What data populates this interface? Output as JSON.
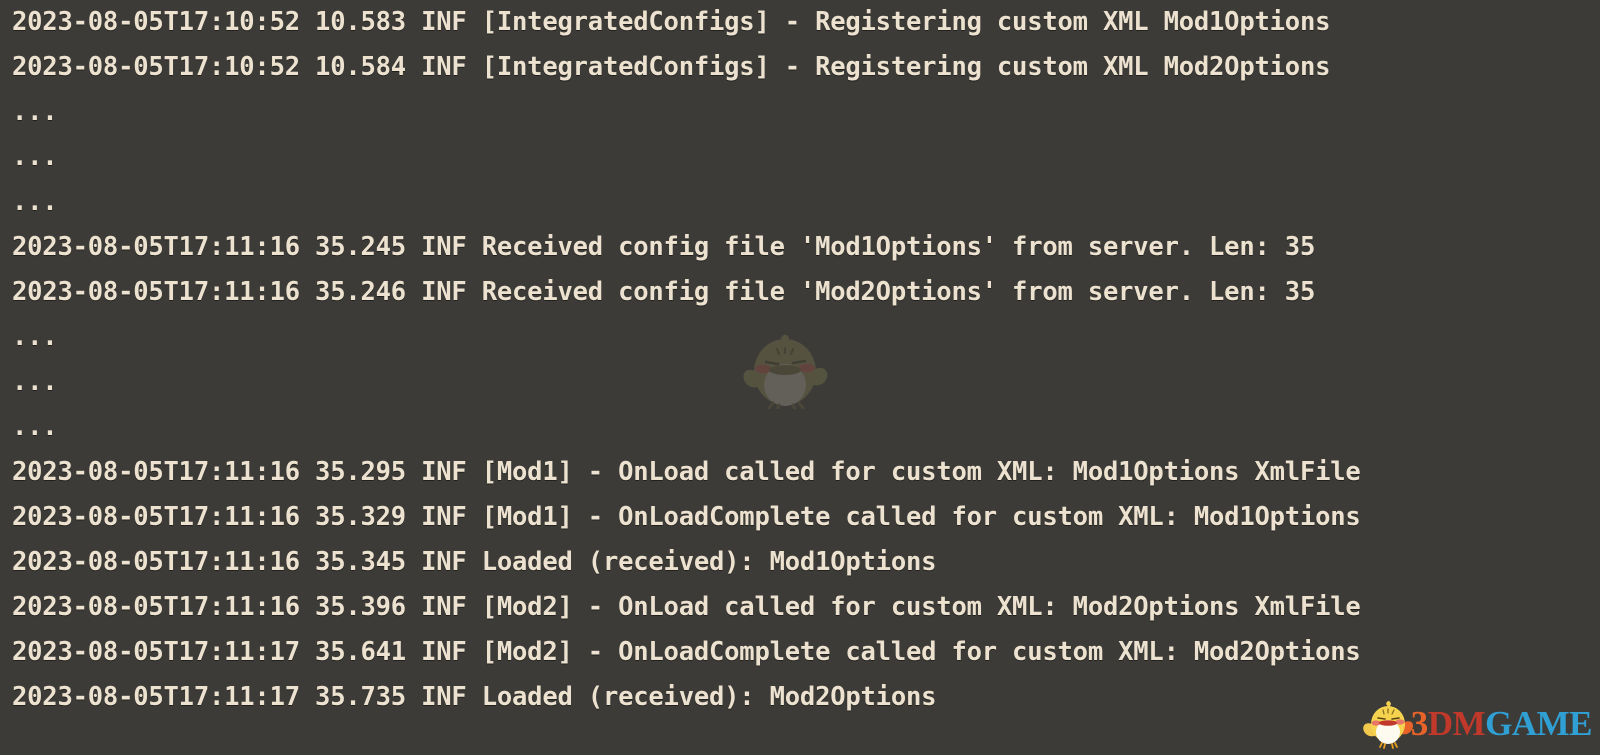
{
  "console": {
    "background_color": "#3c3b38",
    "text_color": "#ece2cf",
    "lines": [
      {
        "id": "line-1",
        "text": "2023-08-05T17:10:52 10.583 INF [IntegratedConfigs] - Registering custom XML Mod1Options"
      },
      {
        "id": "line-2",
        "text": "2023-08-05T17:10:52 10.584 INF [IntegratedConfigs] - Registering custom XML Mod2Options"
      },
      {
        "id": "line-3",
        "text": "..."
      },
      {
        "id": "line-4",
        "text": "..."
      },
      {
        "id": "line-5",
        "text": "..."
      },
      {
        "id": "line-6",
        "text": "2023-08-05T17:11:16 35.245 INF Received config file 'Mod1Options' from server. Len: 35"
      },
      {
        "id": "line-7",
        "text": "2023-08-05T17:11:16 35.246 INF Received config file 'Mod2Options' from server. Len: 35"
      },
      {
        "id": "line-8",
        "text": "..."
      },
      {
        "id": "line-9",
        "text": "..."
      },
      {
        "id": "line-10",
        "text": "..."
      },
      {
        "id": "line-11",
        "text": "2023-08-05T17:11:16 35.295 INF [Mod1] - OnLoad called for custom XML: Mod1Options XmlFile"
      },
      {
        "id": "line-12",
        "text": "2023-08-05T17:11:16 35.329 INF [Mod1] - OnLoadComplete called for custom XML: Mod1Options"
      },
      {
        "id": "line-13",
        "text": "2023-08-05T17:11:16 35.345 INF Loaded (received): Mod1Options"
      },
      {
        "id": "line-14",
        "text": "2023-08-05T17:11:16 35.396 INF [Mod2] - OnLoad called for custom XML: Mod2Options XmlFile"
      },
      {
        "id": "line-15",
        "text": "2023-08-05T17:11:17 35.641 INF [Mod2] - OnLoadComplete called for custom XML: Mod2Options"
      },
      {
        "id": "line-16",
        "text": "2023-08-05T17:11:17 35.735 INF Loaded (received): Mod2Options"
      }
    ]
  },
  "watermark": {
    "mascot_icon": "chick-mascot-icon",
    "opacity": "0.30"
  },
  "brand": {
    "mascot_icon": "chick-mascot-icon",
    "part_1": "3",
    "part_2": "DM",
    "part_3": "GAME",
    "color_1": "#e8632a",
    "color_2": "#c0392b",
    "color_3": "#2f9fd4"
  }
}
